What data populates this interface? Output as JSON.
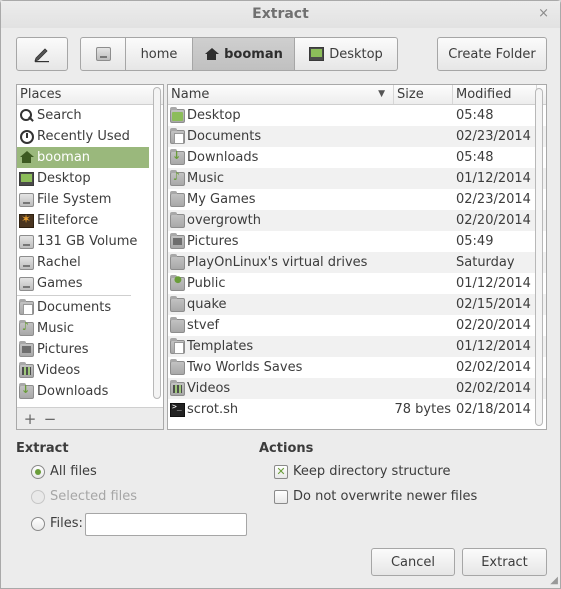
{
  "window": {
    "title": "Extract",
    "close_glyph": "×"
  },
  "toolbar": {
    "edit_icon": "pencil-icon",
    "path": [
      {
        "label": "",
        "icon": "drive-icon"
      },
      {
        "label": "home",
        "icon": ""
      },
      {
        "label": "booman",
        "icon": "home-icon",
        "active": true
      },
      {
        "label": "Desktop",
        "icon": "desktop-icon"
      }
    ],
    "create_folder_label": "Create Folder"
  },
  "places": {
    "header": "Places",
    "items": [
      {
        "label": "Search",
        "icon": "search-icon"
      },
      {
        "label": "Recently Used",
        "icon": "recent-icon"
      },
      {
        "label": "booman",
        "icon": "home-icon",
        "selected": true
      },
      {
        "label": "Desktop",
        "icon": "desktop-icon"
      },
      {
        "label": "File System",
        "icon": "drive-icon"
      },
      {
        "label": "Eliteforce",
        "icon": "game-icon"
      },
      {
        "label": "131 GB Volume",
        "icon": "drive-icon"
      },
      {
        "label": "Rachel",
        "icon": "drive-icon"
      },
      {
        "label": "Games",
        "icon": "drive-icon"
      }
    ],
    "bookmarks": [
      {
        "label": "Documents",
        "icon": "folder-documents-icon"
      },
      {
        "label": "Music",
        "icon": "folder-music-icon"
      },
      {
        "label": "Pictures",
        "icon": "folder-pictures-icon"
      },
      {
        "label": "Videos",
        "icon": "folder-videos-icon"
      },
      {
        "label": "Downloads",
        "icon": "folder-downloads-icon"
      }
    ],
    "add_label": "+",
    "remove_label": "−"
  },
  "files": {
    "columns": {
      "name": "Name",
      "size": "Size",
      "modified": "Modified"
    },
    "sort_indicator": "▼",
    "rows": [
      {
        "name": "Desktop",
        "size": "",
        "modified": "05:48",
        "icon": "folder-desktop-icon"
      },
      {
        "name": "Documents",
        "size": "",
        "modified": "02/23/2014",
        "icon": "folder-documents-icon"
      },
      {
        "name": "Downloads",
        "size": "",
        "modified": "05:48",
        "icon": "folder-downloads-icon"
      },
      {
        "name": "Music",
        "size": "",
        "modified": "01/12/2014",
        "icon": "folder-music-icon"
      },
      {
        "name": "My Games",
        "size": "",
        "modified": "02/23/2014",
        "icon": "folder-icon"
      },
      {
        "name": "overgrowth",
        "size": "",
        "modified": "02/20/2014",
        "icon": "folder-icon"
      },
      {
        "name": "Pictures",
        "size": "",
        "modified": "05:49",
        "icon": "folder-pictures-icon"
      },
      {
        "name": "PlayOnLinux's virtual drives",
        "size": "",
        "modified": "Saturday",
        "icon": "folder-icon"
      },
      {
        "name": "Public",
        "size": "",
        "modified": "01/12/2014",
        "icon": "folder-public-icon"
      },
      {
        "name": "quake",
        "size": "",
        "modified": "02/15/2014",
        "icon": "folder-icon"
      },
      {
        "name": "stvef",
        "size": "",
        "modified": "02/20/2014",
        "icon": "folder-icon"
      },
      {
        "name": "Templates",
        "size": "",
        "modified": "01/12/2014",
        "icon": "folder-templates-icon"
      },
      {
        "name": "Two Worlds Saves",
        "size": "",
        "modified": "02/02/2014",
        "icon": "folder-icon"
      },
      {
        "name": "Videos",
        "size": "",
        "modified": "02/02/2014",
        "icon": "folder-videos-icon"
      },
      {
        "name": "scrot.sh",
        "size": "78 bytes",
        "modified": "02/18/2014",
        "icon": "terminal-script-icon"
      }
    ]
  },
  "extract": {
    "title": "Extract",
    "all_files": "All files",
    "selected_files": "Selected files",
    "files_label": "Files:",
    "files_value": "",
    "selected": "all_files"
  },
  "actions": {
    "title": "Actions",
    "keep_structure": "Keep directory structure",
    "keep_structure_checked": true,
    "no_overwrite": "Do not overwrite newer files",
    "no_overwrite_checked": false
  },
  "buttons": {
    "cancel": "Cancel",
    "extract": "Extract"
  },
  "colors": {
    "accent": "#9ab87c",
    "accent_dark": "#6a9d3a"
  }
}
